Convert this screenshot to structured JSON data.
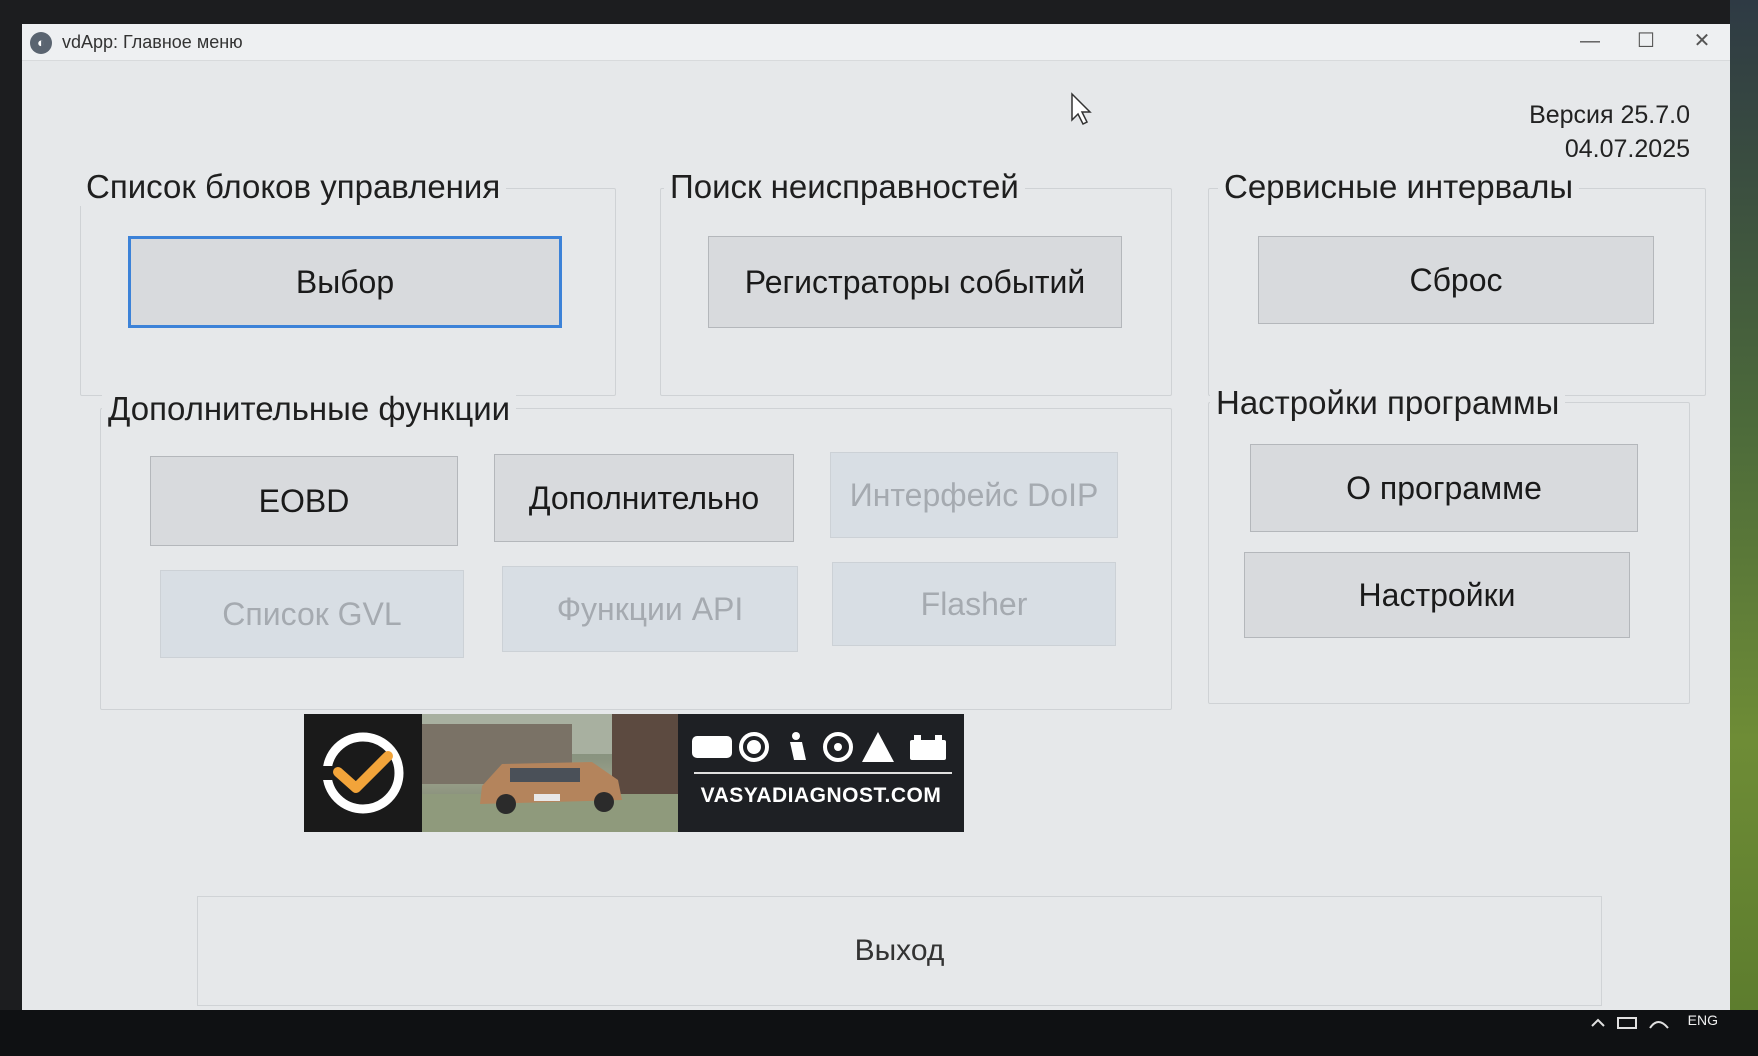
{
  "window": {
    "title": "vdApp: Главное меню",
    "controls": {
      "minimize": "—",
      "maximize": "☐",
      "close": "✕"
    }
  },
  "version": {
    "label": "Версия 25.7.0",
    "date": "04.07.2025"
  },
  "groups": {
    "control_units": {
      "label": "Список блоков управления",
      "button": "Выбор"
    },
    "troubleshooting": {
      "label": "Поиск неисправностей",
      "button": "Регистраторы событий"
    },
    "service": {
      "label": "Сервисные интервалы",
      "button": "Сброс"
    },
    "extra": {
      "label": "Дополнительные функции",
      "buttons": {
        "eobd": "EOBD",
        "additional": "Дополнительно",
        "doip": "Интерфейс DoIP",
        "gvl": "Список GVL",
        "api": "Функции API",
        "flasher": "Flasher"
      }
    },
    "settings": {
      "label": "Настройки программы",
      "about": "О программе",
      "settings": "Настройки"
    }
  },
  "banner": {
    "url": "VASYADIAGNOST.COM"
  },
  "exit_button": "Выход",
  "taskbar": {
    "language": "ENG"
  }
}
